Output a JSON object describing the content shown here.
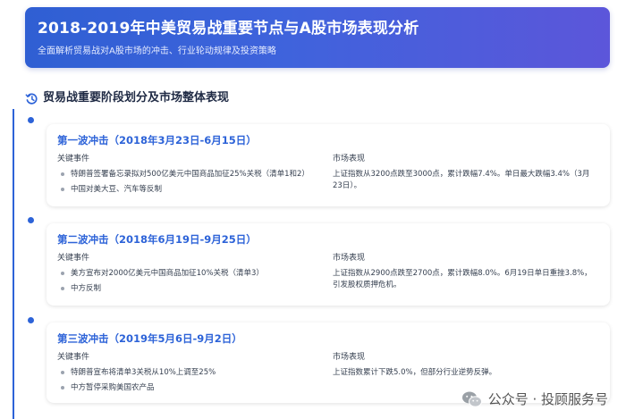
{
  "banner": {
    "title": "2018-2019年中美贸易战重要节点与A股市场表现分析",
    "subtitle": "全面解析贸易战对A股市场的冲击、行业轮动规律及投资策略"
  },
  "section": {
    "title": "贸易战重要阶段划分及市场整体表现",
    "icon": "history-icon"
  },
  "labels": {
    "events_header": "关键事件",
    "market_header": "市场表现"
  },
  "waves": [
    {
      "title": "第一波冲击（2018年3月23日-6月15日）",
      "events": [
        "特朗普签署备忘录拟对500亿美元中国商品加征25%关税（清单1和2）",
        "中国对美大豆、汽车等反制"
      ],
      "market": "上证指数从3200点跌至3000点，累计跌幅7.4%。单日最大跌幅3.4%（3月23日）。"
    },
    {
      "title": "第二波冲击（2018年6月19日-9月25日）",
      "events": [
        "美方宣布对2000亿美元中国商品加征10%关税（清单3）",
        "中方反制"
      ],
      "market": "上证指数从2900点跌至2700点，累计跌幅8.0%。6月19日单日重挫3.8%，引发股权质押危机。"
    },
    {
      "title": "第三波冲击（2019年5月6日-9月2日）",
      "events": [
        "特朗普宣布将清单3关税从10%上调至25%",
        "中方暂停采购美国农产品"
      ],
      "market": "上证指数累计下跌5.0%，但部分行业逆势反弹。"
    }
  ],
  "watermark": {
    "text": "公众号 · 投顾服务号",
    "icon": "wechat-icon"
  }
}
